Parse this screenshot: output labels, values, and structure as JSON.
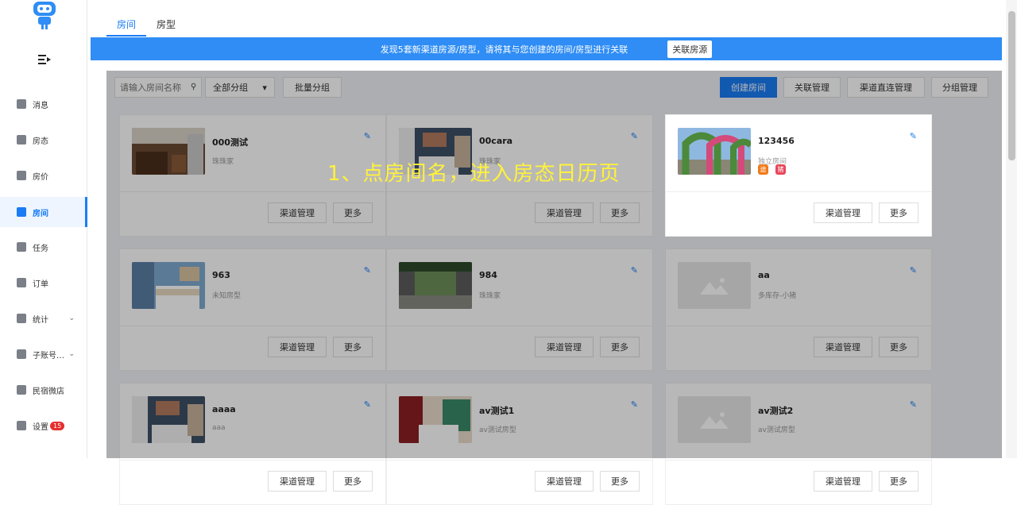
{
  "sidebar": {
    "items": [
      {
        "label": "消息",
        "icon": "message-icon",
        "active": false
      },
      {
        "label": "房态",
        "icon": "calendar-icon",
        "active": false
      },
      {
        "label": "房价",
        "icon": "price-icon",
        "active": false
      },
      {
        "label": "房间",
        "icon": "home-icon",
        "active": true
      },
      {
        "label": "任务",
        "icon": "task-icon",
        "active": false
      },
      {
        "label": "订单",
        "icon": "order-icon",
        "active": false
      },
      {
        "label": "统计",
        "icon": "chart-icon",
        "active": false,
        "chevron": "⌄"
      },
      {
        "label": "子账号…",
        "icon": "users-icon",
        "active": false,
        "chevron": "⌄"
      },
      {
        "label": "民宿微店",
        "icon": "shop-icon",
        "active": false
      },
      {
        "label": "设置",
        "icon": "settings-icon",
        "active": false,
        "badge": "15"
      }
    ]
  },
  "tabs": [
    {
      "label": "房间",
      "active": true
    },
    {
      "label": "房型",
      "active": false
    }
  ],
  "banner": {
    "text": "发现5套新渠道房源/房型，请将其与您创建的房间/房型进行关联",
    "button": "关联房源",
    "color": "#2f8df5"
  },
  "toolbar": {
    "search_placeholder": "请输入房间名称",
    "group_select": "全部分组",
    "batch_group": "批量分组",
    "create": "创建房间",
    "link_manage": "关联管理",
    "direct_manage": "渠道直连管理",
    "group_manage": "分组管理"
  },
  "rooms": [
    {
      "name": "000测试",
      "sub": "珠珠家",
      "image": "kitchen"
    },
    {
      "name": "00cara",
      "sub": "珠珠家",
      "image": "blue-room"
    },
    {
      "name": "123456",
      "sub": "独立房间",
      "image": "arch-garden",
      "highlight": true,
      "channels": [
        "途",
        "猪"
      ]
    },
    {
      "name": "963",
      "sub": "未知房型",
      "image": "bedroom"
    },
    {
      "name": "984",
      "sub": "珠珠家",
      "image": "courtyard"
    },
    {
      "name": "aa",
      "sub": "多库存-小猪",
      "image": "placeholder"
    },
    {
      "name": "aaaa",
      "sub": "aaa",
      "image": "blue-room"
    },
    {
      "name": "av测试1",
      "sub": "av测试房型",
      "image": "hotel-room"
    },
    {
      "name": "av测试2",
      "sub": "av测试房型",
      "image": "placeholder"
    }
  ],
  "card_buttons": {
    "channel": "渠道管理",
    "more": "更多"
  },
  "annotation": {
    "text": "1、点房间名，进入房态日历页",
    "color": "#fff23a"
  },
  "colors": {
    "accent": "#1a7cf4",
    "overlay": "rgba(0,0,0,0.28)"
  }
}
